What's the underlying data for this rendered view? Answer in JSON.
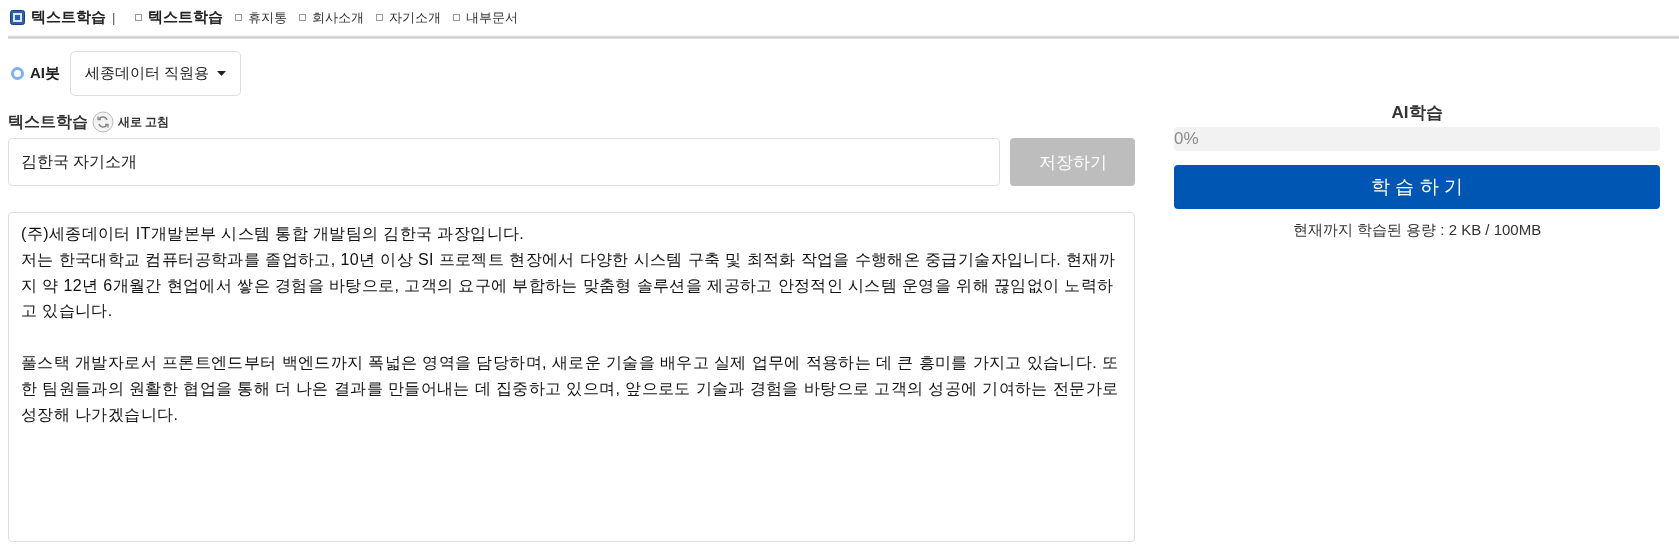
{
  "header": {
    "title": "텍스트학습",
    "separator": "|",
    "nav": [
      {
        "label": "텍스트학습",
        "selected": true
      },
      {
        "label": "휴지통",
        "selected": false
      },
      {
        "label": "회사소개",
        "selected": false
      },
      {
        "label": "자기소개",
        "selected": false
      },
      {
        "label": "내부문서",
        "selected": false
      }
    ]
  },
  "bot": {
    "label": "AI봇",
    "dropdown": "세종데이터 직원용"
  },
  "editor": {
    "heading": "텍스트학습",
    "refresh_label": "새로 고침",
    "title_field": {
      "value": "김한국 자기소개"
    },
    "save_button": {
      "label": "저장하기",
      "disabled": true
    },
    "body": "(주)세종데이터 IT개발본부 시스템 통합 개발팀의 김한국 과장입니다.\n저는 한국대학교 컴퓨터공학과를 졸업하고, 10년 이상 SI 프로젝트 현장에서 다양한 시스템 구축 및 최적화 작업을 수행해온 중급기술자입니다. 현재까지 약 12년 6개월간 현업에서 쌓은 경험을 바탕으로, 고객의 요구에 부합하는 맞춤형 솔루션을 제공하고 안정적인 시스템 운영을 위해 끊임없이 노력하고 있습니다.\n\n풀스택 개발자로서 프론트엔드부터 백엔드까지 폭넓은 영역을 담당하며, 새로운 기술을 배우고 실제 업무에 적용하는 데 큰 흥미를 가지고 있습니다. 또한 팀원들과의 원활한 협업을 통해 더 나은 결과를 만들어내는 데 집중하고 있으며, 앞으로도 기술과 경험을 바탕으로 고객의 성공에 기여하는 전문가로 성장해 나가겠습니다."
  },
  "training": {
    "heading": "AI학습",
    "progress": {
      "level": 0,
      "reading": "0%"
    },
    "button": "학 습 하 기",
    "usage": "현재까지 학습된 용량 : 2 KB / 100MB"
  }
}
